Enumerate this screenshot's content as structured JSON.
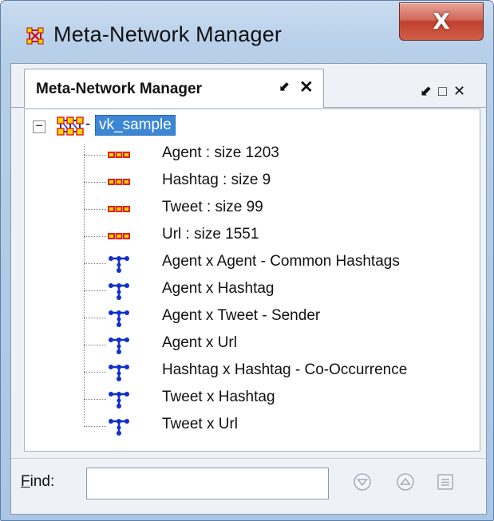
{
  "window": {
    "title": "Meta-Network Manager",
    "close_glyph": "X"
  },
  "tab": {
    "label": "Meta-Network Manager",
    "pin_glyph": "⬋",
    "close_glyph": "✕"
  },
  "panel_controls": {
    "pin_glyph": "⬋",
    "maximize_glyph": "□",
    "close_glyph": "✕"
  },
  "tree": {
    "root": {
      "expander": "−",
      "connector": "-",
      "label": "vk_sample",
      "icon": "meta-network-icon"
    },
    "nodes": [
      {
        "label": "Agent : size 1203",
        "icon": "nodeset-icon"
      },
      {
        "label": "Hashtag : size 9",
        "icon": "nodeset-icon"
      },
      {
        "label": "Tweet : size 99",
        "icon": "nodeset-icon"
      },
      {
        "label": "Url : size 1551",
        "icon": "nodeset-icon"
      },
      {
        "label": "Agent x Agent - Common Hashtags",
        "icon": "network-icon"
      },
      {
        "label": "Agent x Hashtag",
        "icon": "network-icon"
      },
      {
        "label": "Agent x Tweet - Sender",
        "icon": "network-icon"
      },
      {
        "label": "Agent x Url",
        "icon": "network-icon"
      },
      {
        "label": "Hashtag x Hashtag - Co-Occurrence",
        "icon": "network-icon"
      },
      {
        "label": "Tweet x Hashtag",
        "icon": "network-icon"
      },
      {
        "label": "Tweet x Url",
        "icon": "network-icon"
      }
    ]
  },
  "find": {
    "label_accel": "F",
    "label_rest": "ind:",
    "value": "",
    "placeholder": ""
  },
  "colors": {
    "title_bg": "#b7cfe9",
    "close_red": "#c2402f",
    "selection": "#3b87d6",
    "nodeset_red": "#e02020",
    "nodeset_yellow": "#f5d800",
    "network_blue": "#1030c8"
  }
}
